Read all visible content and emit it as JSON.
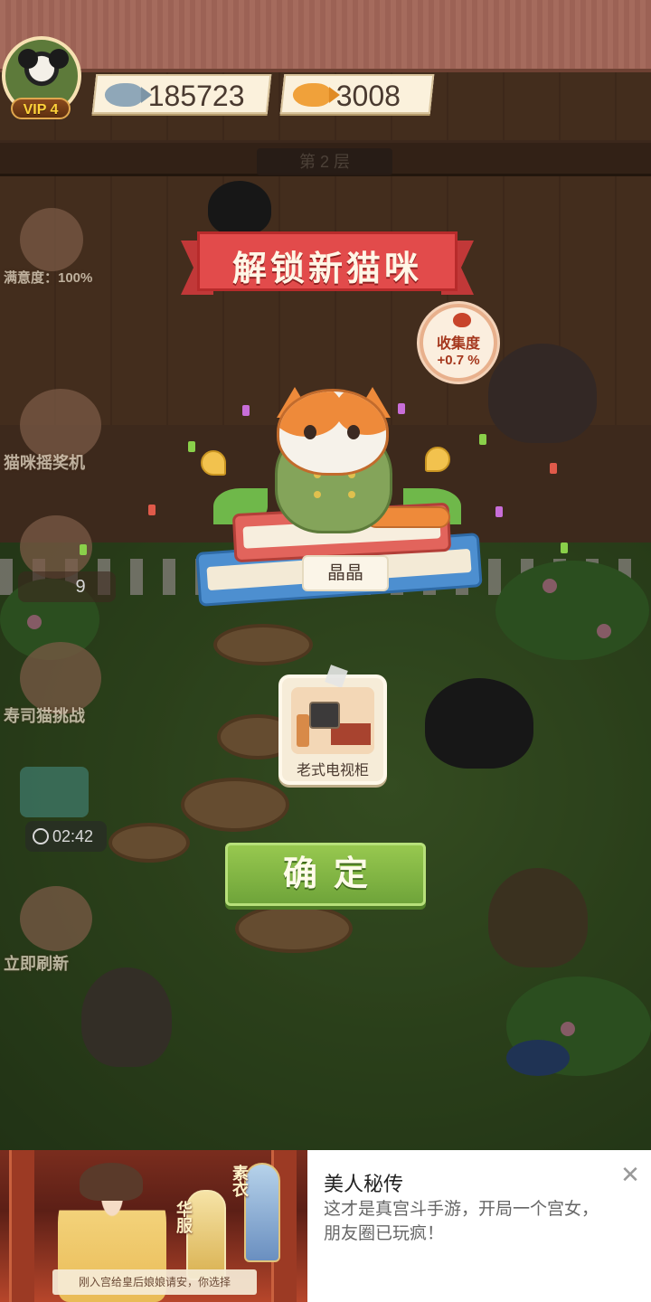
{
  "hud": {
    "vip_level": "VIP 4",
    "fish_amount": "185723",
    "goldfish_amount": "3008",
    "floor_sign": "第 2 层"
  },
  "sidebar": {
    "satisfaction": "满意度：100%",
    "slot_machine": "猫咪摇奖机",
    "fish_count": "9",
    "sushi_challenge": "寿司猫挑战",
    "timer": "02:42",
    "refresh_now": "立即刷新"
  },
  "popup": {
    "title": "解锁新猫咪",
    "collection_label": "收集度",
    "collection_value": "+0.7 %",
    "cat_name": "晶晶",
    "reward_item": "老式电视柜",
    "confirm_label": "确定"
  },
  "ad": {
    "title": "美人秘传",
    "description": "这才是真宫斗手游，开局一个宫女，朋友圈已玩疯！",
    "caption": "刚入宫给皇后娘娘请安，你选择",
    "tag_left": "华服",
    "tag_right": "素衣",
    "close_symbol": "✕"
  },
  "colors": {
    "ribbon_red": "#e24b4b",
    "confirm_green": "#7fb443",
    "overlay": "rgba(0,0,0,0.45)"
  }
}
